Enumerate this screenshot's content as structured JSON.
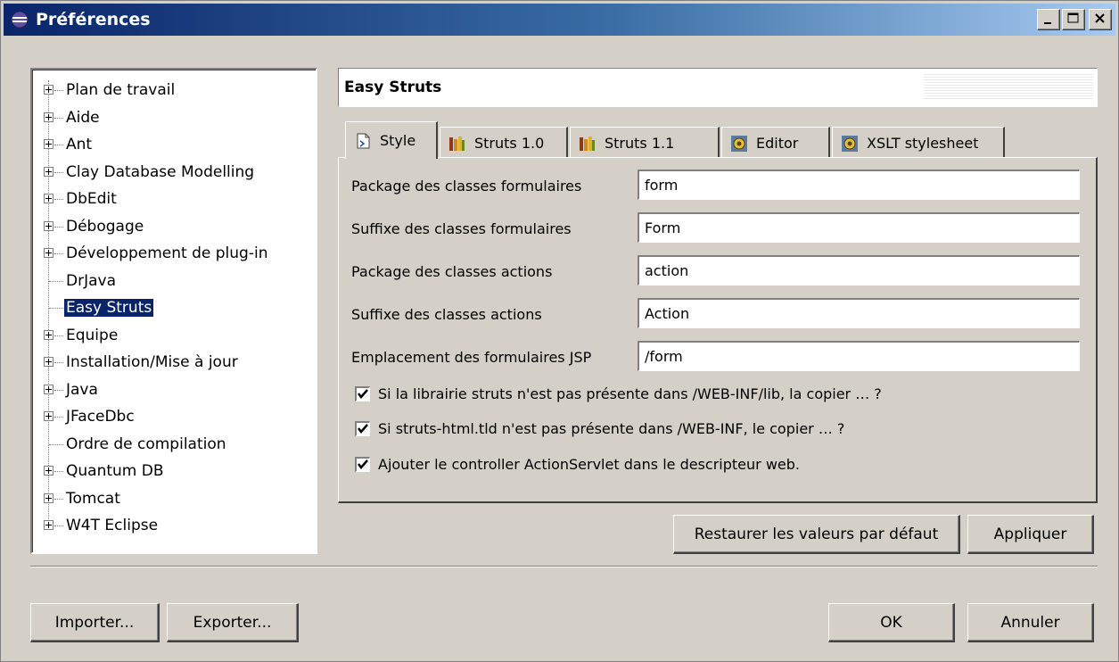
{
  "window": {
    "title": "Préférences",
    "controls": [
      "minimize",
      "maximize",
      "close"
    ]
  },
  "tree": {
    "items": [
      {
        "label": "Plan de travail",
        "expandable": true
      },
      {
        "label": "Aide",
        "expandable": true
      },
      {
        "label": "Ant",
        "expandable": true
      },
      {
        "label": "Clay Database Modelling",
        "expandable": true
      },
      {
        "label": "DbEdit",
        "expandable": true
      },
      {
        "label": "Débogage",
        "expandable": true
      },
      {
        "label": "Développement de plug-in",
        "expandable": true
      },
      {
        "label": "DrJava",
        "expandable": false
      },
      {
        "label": "Easy Struts",
        "expandable": false,
        "selected": true
      },
      {
        "label": "Equipe",
        "expandable": true
      },
      {
        "label": "Installation/Mise à jour",
        "expandable": true
      },
      {
        "label": "Java",
        "expandable": true
      },
      {
        "label": "JFaceDbc",
        "expandable": true
      },
      {
        "label": "Ordre de compilation",
        "expandable": false
      },
      {
        "label": "Quantum DB",
        "expandable": true
      },
      {
        "label": "Tomcat",
        "expandable": true
      },
      {
        "label": "W4T Eclipse",
        "expandable": true
      }
    ]
  },
  "panel": {
    "title": "Easy Struts",
    "tabs": [
      {
        "label": "Style",
        "icon": "page-icon",
        "active": true
      },
      {
        "label": "Struts 1.0",
        "icon": "books-icon"
      },
      {
        "label": "Struts 1.1",
        "icon": "books-icon"
      },
      {
        "label": "Editor",
        "icon": "gear-icon"
      },
      {
        "label": "XSLT stylesheet",
        "icon": "gear-icon"
      }
    ],
    "fields": [
      {
        "label": "Package des classes formulaires",
        "value": "form"
      },
      {
        "label": "Suffixe des classes formulaires",
        "value": "Form"
      },
      {
        "label": "Package des classes actions",
        "value": "action"
      },
      {
        "label": "Suffixe des classes actions",
        "value": "Action"
      },
      {
        "label": "Emplacement des formulaires JSP",
        "value": "/form"
      }
    ],
    "checkboxes": [
      {
        "label": "Si la librairie struts n'est pas présente dans /WEB-INF/lib, la copier … ?",
        "checked": true
      },
      {
        "label": "Si struts-html.tld n'est pas présente dans /WEB-INF, le copier … ?",
        "checked": true
      },
      {
        "label": "Ajouter le controller ActionServlet dans le descripteur web.",
        "checked": true
      }
    ],
    "restore_label": "Restaurer les valeurs par défaut",
    "apply_label": "Appliquer"
  },
  "footer": {
    "import_label": "Importer...",
    "export_label": "Exporter...",
    "ok_label": "OK",
    "cancel_label": "Annuler"
  }
}
